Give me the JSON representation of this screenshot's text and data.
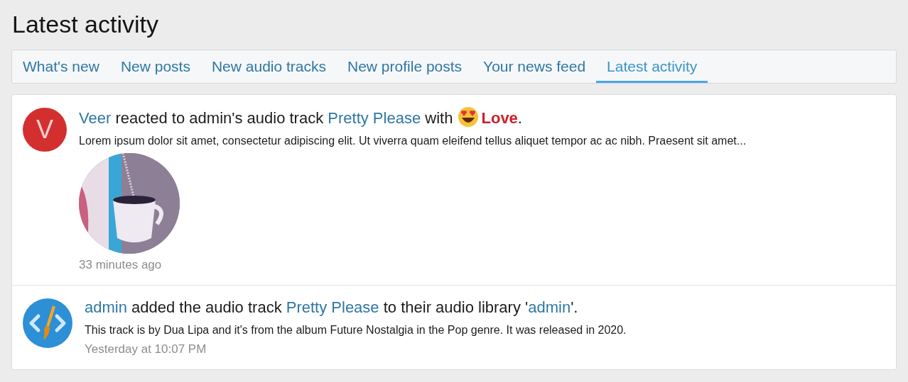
{
  "page_title": "Latest activity",
  "tabs": [
    {
      "label": "What's new",
      "selected": false
    },
    {
      "label": "New posts",
      "selected": false
    },
    {
      "label": "New audio tracks",
      "selected": false
    },
    {
      "label": "New profile posts",
      "selected": false
    },
    {
      "label": "Your news feed",
      "selected": false
    },
    {
      "label": "Latest activity",
      "selected": true
    }
  ],
  "activity": [
    {
      "avatar": {
        "kind": "letter",
        "letter": "V",
        "color": "#d32f2f"
      },
      "headline": [
        {
          "kind": "link",
          "text": "Veer"
        },
        {
          "kind": "text",
          "text": " reacted to admin's audio track "
        },
        {
          "kind": "link",
          "text": "Pretty Please"
        },
        {
          "kind": "text",
          "text": " with "
        },
        {
          "kind": "reaction",
          "text": "Love"
        },
        {
          "kind": "text",
          "text": "."
        }
      ],
      "snippet": "Lorem ipsum dolor sit amet, consectetur adipiscing elit. Ut viverra quam eleifend tellus aliquet tempor ac ac nibh. Praesent sit amet...",
      "time": "33 minutes ago"
    },
    {
      "avatar": {
        "kind": "icon",
        "color": "#2d8fd5"
      },
      "headline": [
        {
          "kind": "link",
          "text": "admin"
        },
        {
          "kind": "text",
          "text": " added the audio track "
        },
        {
          "kind": "link",
          "text": "Pretty Please"
        },
        {
          "kind": "text",
          "text": " to their audio library '"
        },
        {
          "kind": "link",
          "text": "admin"
        },
        {
          "kind": "text",
          "text": "'."
        }
      ],
      "snippet": "This track is by Dua Lipa and it's from the album Future Nostalgia in the Pop genre. It was released in 2020.",
      "time": "Yesterday at 10:07 PM"
    }
  ]
}
